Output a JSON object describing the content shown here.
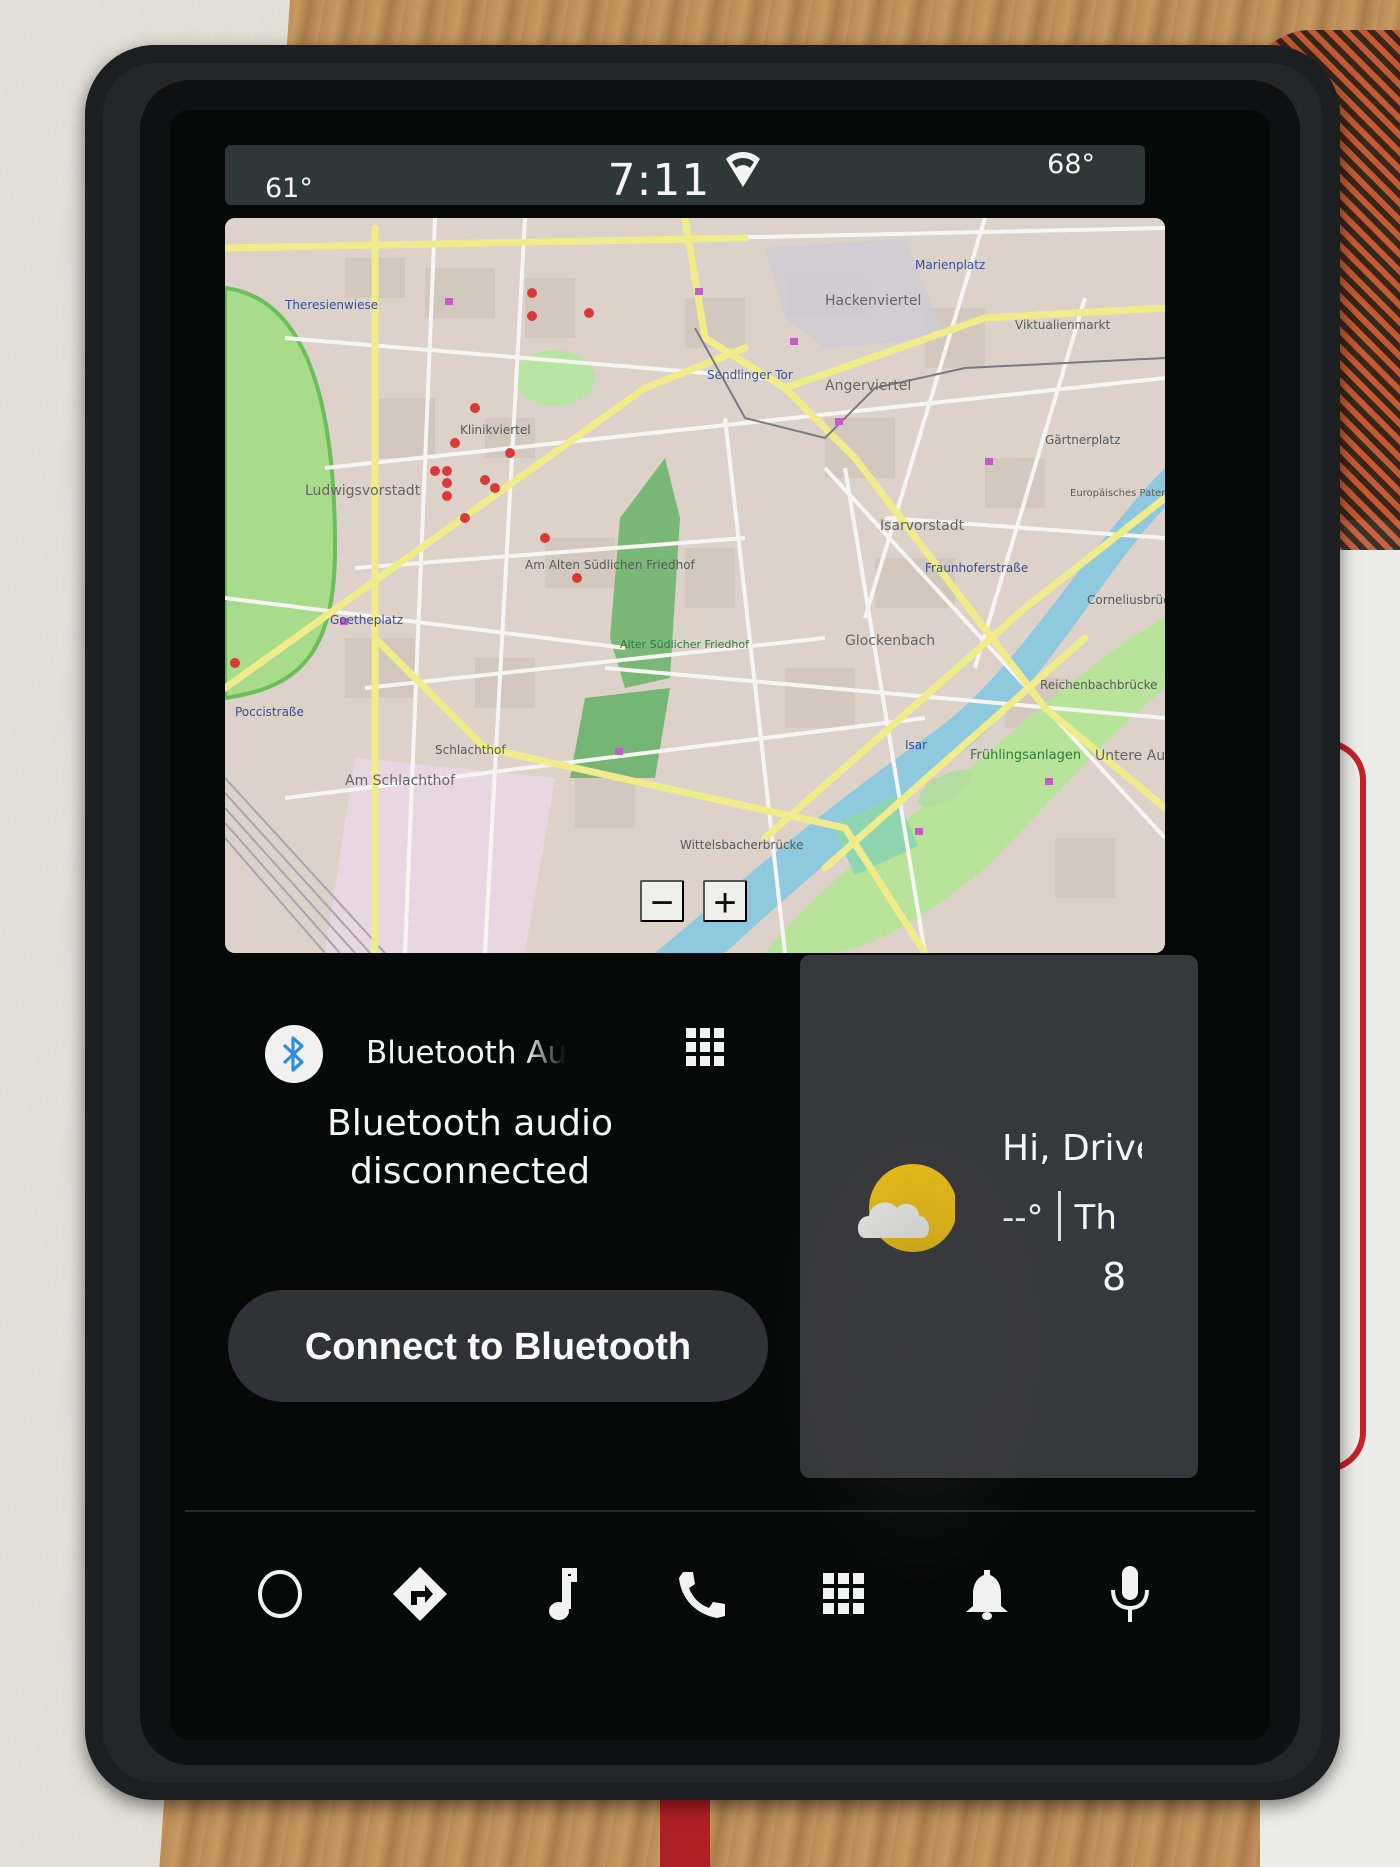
{
  "status_bar": {
    "left_temp": "61°",
    "time": "7:11",
    "wifi_icon": "wifi-icon",
    "right_temp": "68°"
  },
  "map": {
    "labels": {
      "ludwigsvorstadt": "Ludwigsvorstadt",
      "klinikviertel": "Klinikviertel",
      "hackenviertel": "Hackenviertel",
      "angerviertel": "Angerviertel",
      "marienplatz": "Marienplatz",
      "viktualienmarkt": "Viktualienmarkt",
      "sendlinger_tor": "Sendlinger Tor",
      "gaertnerplatz": "Gärtnerplatz",
      "isarvorstadt": "Isarvorstadt",
      "am_alten_suedlichen_friedhof": "Am Alten Südlichen Friedhof",
      "alter_suedlicher_friedhof": "Alter Südlicher Friedhof",
      "goetheplatz": "Goetheplatz",
      "glockenbach": "Glockenbach",
      "fraunhoferstrasse": "Fraunhoferstraße",
      "reichenbachbruecke": "Reichenbachbrücke",
      "corneliusbruecke": "Corneliusbrücke",
      "europaeisches_patentamt": "Europäisches Patentamt",
      "am_schlachthof": "Am Schlachthof",
      "schlachthof": "Schlachthof",
      "poccistrasse": "Poccistraße",
      "theresienwiese": "Theresienwiese",
      "fruehlingsanlagen": "Frühlingsanlagen",
      "wittelsbacherbruecke": "Wittelsbacherbrücke",
      "untere_au": "Untere Au",
      "isar": "Isar"
    },
    "zoom_out_label": "−",
    "zoom_in_label": "+"
  },
  "media_card": {
    "source_icon": "bluetooth-icon",
    "title": "Bluetooth Audio",
    "status": "Bluetooth audio disconnected",
    "apps_icon": "app-grid-icon",
    "connect_button": "Connect to Bluetooth",
    "accent_color": "#2f8de4"
  },
  "weather_card": {
    "icon": "partly-cloudy-icon",
    "greeting": "Hi, Driver",
    "temperature": "--°",
    "day": "Th",
    "date": "8"
  },
  "nav_bar": {
    "items": [
      {
        "name": "home",
        "icon": "home-circle-icon"
      },
      {
        "name": "navigation",
        "icon": "navigation-icon"
      },
      {
        "name": "media",
        "icon": "music-note-icon"
      },
      {
        "name": "phone",
        "icon": "phone-icon"
      },
      {
        "name": "app-launcher",
        "icon": "app-grid-icon"
      },
      {
        "name": "notifications",
        "icon": "bell-icon"
      },
      {
        "name": "voice-assistant",
        "icon": "microphone-icon"
      }
    ]
  }
}
